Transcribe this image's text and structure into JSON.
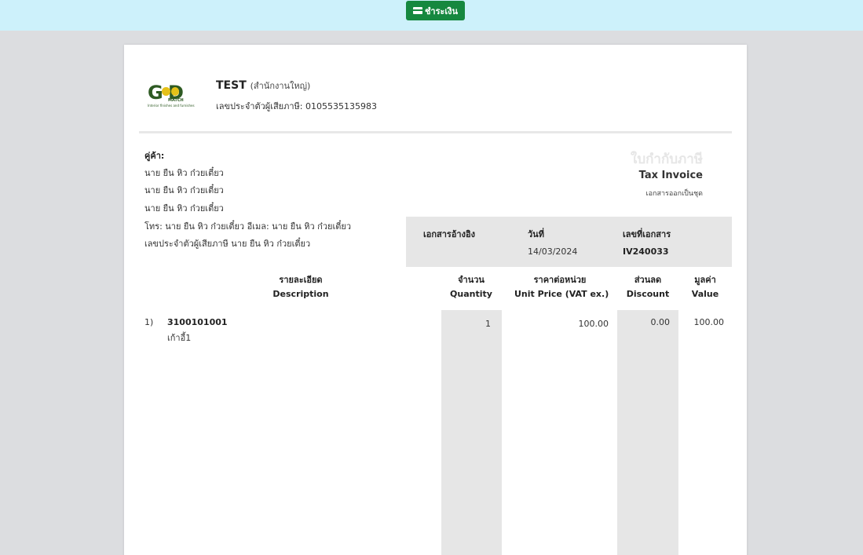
{
  "toolbar": {
    "pay_label": "ชำระเงิน",
    "pay_icon": "credit-card-icon",
    "accent": "#16883f"
  },
  "logo": {
    "word": "G  D",
    "sub": "MATCH",
    "tagline": "Interior finishes and furnishes"
  },
  "company": {
    "name": "TEST",
    "branch": "(สำนักงานใหญ่)",
    "tax_id_line": "เลขประจำตัวผู้เสียภาษี: 0105535135983"
  },
  "customer": {
    "title": "คู่ค้า:",
    "lines": [
      "นาย ยืน หิว ก๋วยเตี๋ยว",
      "นาย ยืน หิว ก๋วยเตี๋ยว",
      "นาย ยืน หิว ก๋วยเตี๋ยว",
      "โทร: นาย ยืน หิว ก๋วยเตี๋ยว อีเมล: นาย ยืน หิว ก๋วยเตี๋ยว",
      "เลขประจำตัวผู้เสียภาษี นาย ยืน หิว ก๋วยเตี๋ยว"
    ]
  },
  "document": {
    "title_th": "ใบกำกับภาษี",
    "title_en": "Tax Invoice",
    "set_note": "เอกสารออกเป็นชุด"
  },
  "meta": {
    "reference_label": "เอกสารอ้างอิง",
    "date_label": "วันที่",
    "date_value": "14/03/2024",
    "number_label": "เลขที่เอกสาร",
    "number_value": "IV240033"
  },
  "table": {
    "headers": {
      "description_th": "รายละเอียด",
      "description_en": "Description",
      "quantity_th": "จำนวน",
      "quantity_en": "Quantity",
      "unit_price_th": "ราคาต่อหน่วย",
      "unit_price_en": "Unit Price (VAT ex.)",
      "discount_th": "ส่วนลด",
      "discount_en": "Discount",
      "value_th": "มูลค่า",
      "value_en": "Value"
    },
    "rows": [
      {
        "index": "1)",
        "code": "3100101001",
        "name": "เก้าอี้1",
        "quantity": "1",
        "unit_price": "100.00",
        "discount": "0.00",
        "value": "100.00"
      }
    ]
  }
}
